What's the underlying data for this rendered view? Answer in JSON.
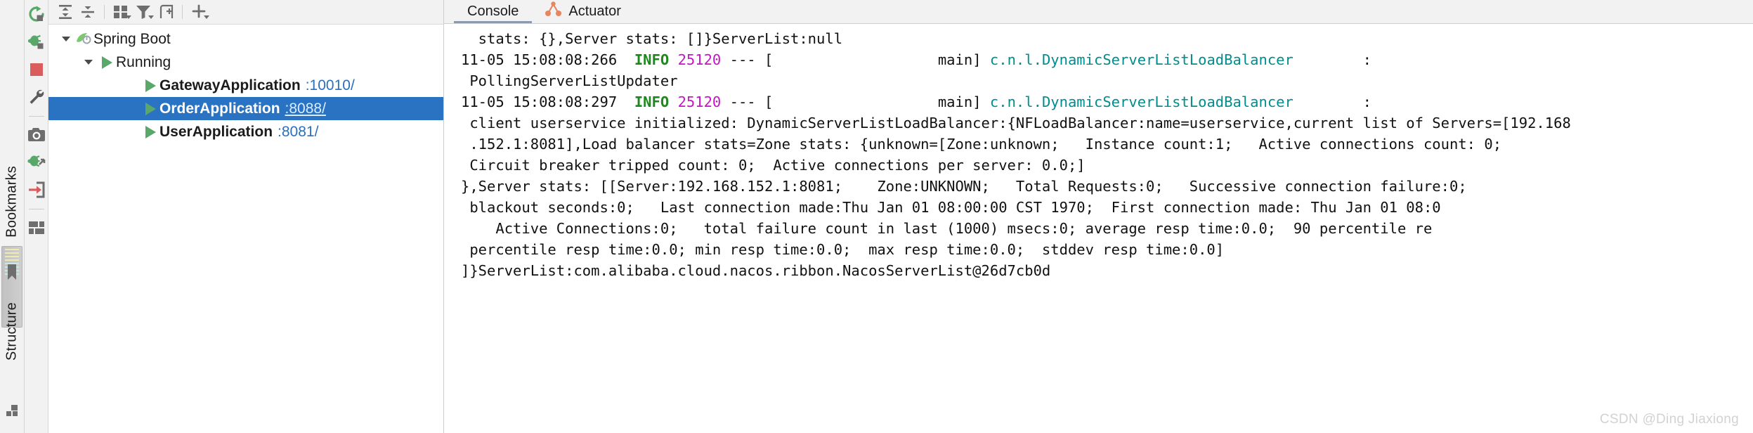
{
  "strip": {
    "bookmarks_label": "Bookmarks",
    "structure_label": "Structure",
    "bookmark_icon": "bookmark-icon",
    "bottom_icon": "layout-icon"
  },
  "run_toolbar": {
    "buttons": [
      {
        "name": "rerun-button",
        "icon": "rerun-icon",
        "color": "#59a869"
      },
      {
        "name": "rerun-debug-button",
        "icon": "debug-rerun-icon",
        "color": "#59a869"
      },
      {
        "name": "stop-button",
        "icon": "stop-square-icon",
        "color": "#db5c5c"
      },
      {
        "name": "settings-button",
        "icon": "wrench-icon",
        "color": "#5c5c5c"
      },
      {
        "name": "screenshot-button",
        "icon": "camera-icon",
        "color": "#6e6e6e"
      },
      {
        "name": "attach-debugger-button",
        "icon": "debug-attach-icon",
        "color": "#59a869"
      },
      {
        "name": "import-button",
        "icon": "arrow-into-box-icon",
        "color": "#db5c5c"
      },
      {
        "name": "layout-button",
        "icon": "layout-icon",
        "color": "#6e6e6e"
      }
    ]
  },
  "tree_toolbar": {
    "buttons": [
      {
        "name": "expand-all-button",
        "icon": "expand-all-icon",
        "caret": false
      },
      {
        "name": "collapse-all-button",
        "icon": "collapse-all-icon",
        "caret": false
      },
      {
        "name": "group-by-button",
        "icon": "group-by-icon",
        "caret": true
      },
      {
        "name": "filter-button",
        "icon": "filter-icon",
        "caret": true
      },
      {
        "name": "add-endpoint-button",
        "icon": "add-frame-icon",
        "caret": false
      },
      {
        "name": "add-button",
        "icon": "plus-icon",
        "caret": true
      }
    ]
  },
  "tabs": [
    {
      "label": "Console",
      "icon": "console-icon",
      "active": true
    },
    {
      "label": "Actuator",
      "icon": "actuator-icon",
      "active": false
    }
  ],
  "tree": {
    "nodes": [
      {
        "label": "Spring Boot",
        "port": "",
        "icon": "spring-boot-icon",
        "indent": 0,
        "expanded": true,
        "bold": false,
        "selected": false,
        "name": "tree-node-spring-boot"
      },
      {
        "label": "Running",
        "port": "",
        "icon": "play-icon",
        "indent": 1,
        "expanded": true,
        "bold": false,
        "selected": false,
        "name": "tree-node-running"
      },
      {
        "label": "GatewayApplication",
        "port": ":10010/",
        "icon": "play-icon",
        "indent": 2,
        "expanded": null,
        "bold": true,
        "selected": false,
        "name": "tree-node-gateway-application"
      },
      {
        "label": "OrderApplication",
        "port": ":8088/",
        "icon": "play-icon",
        "indent": 2,
        "expanded": null,
        "bold": true,
        "selected": true,
        "name": "tree-node-order-application"
      },
      {
        "label": "UserApplication",
        "port": ":8081/",
        "icon": "play-icon",
        "indent": 2,
        "expanded": null,
        "bold": true,
        "selected": false,
        "name": "tree-node-user-application"
      }
    ]
  },
  "console": {
    "lines": [
      {
        "segments": [
          {
            "t": "  stats: {},Server stats: []}ServerList:null",
            "c": "txt"
          }
        ]
      },
      {
        "segments": [
          {
            "t": "11-05 15:08:08:266 ",
            "c": "ts"
          },
          {
            "t": " INFO",
            "c": "info"
          },
          {
            "t": " ",
            "c": "txt"
          },
          {
            "t": "25120",
            "c": "pid"
          },
          {
            "t": " --- [                   main] ",
            "c": "txt"
          },
          {
            "t": "c.n.l.DynamicServerListLoadBalancer",
            "c": "cls"
          },
          {
            "t": "        :",
            "c": "txt"
          }
        ]
      },
      {
        "segments": [
          {
            "t": " PollingServerListUpdater",
            "c": "txt"
          }
        ]
      },
      {
        "segments": [
          {
            "t": "11-05 15:08:08:297 ",
            "c": "ts"
          },
          {
            "t": " INFO",
            "c": "info"
          },
          {
            "t": " ",
            "c": "txt"
          },
          {
            "t": "25120",
            "c": "pid"
          },
          {
            "t": " --- [                   main] ",
            "c": "txt"
          },
          {
            "t": "c.n.l.DynamicServerListLoadBalancer",
            "c": "cls"
          },
          {
            "t": "        :",
            "c": "txt"
          }
        ]
      },
      {
        "segments": [
          {
            "t": " client userservice initialized: DynamicServerListLoadBalancer:{NFLoadBalancer:name=userservice,current list of Servers=[192.168",
            "c": "txt"
          }
        ]
      },
      {
        "segments": [
          {
            "t": " .152.1:8081],Load balancer stats=Zone stats: {unknown=[Zone:unknown;   Instance count:1;   Active connections count: 0;",
            "c": "txt"
          }
        ]
      },
      {
        "segments": [
          {
            "t": " Circuit breaker tripped count: 0;  Active connections per server: 0.0;]",
            "c": "txt"
          }
        ]
      },
      {
        "segments": [
          {
            "t": "},Server stats: [[Server:192.168.152.1:8081;    Zone:UNKNOWN;   Total Requests:0;   Successive connection failure:0;",
            "c": "txt"
          }
        ]
      },
      {
        "segments": [
          {
            "t": " blackout seconds:0;   Last connection made:Thu Jan 01 08:00:00 CST 1970;  First connection made: Thu Jan 01 08:0",
            "c": "txt"
          }
        ]
      },
      {
        "segments": [
          {
            "t": "    Active Connections:0;   total failure count in last (1000) msecs:0; average resp time:0.0;  90 percentile re",
            "c": "txt"
          }
        ]
      },
      {
        "segments": [
          {
            "t": " percentile resp time:0.0; min resp time:0.0;  max resp time:0.0;  stddev resp time:0.0]",
            "c": "txt"
          }
        ]
      },
      {
        "segments": [
          {
            "t": "]}ServerList:com.alibaba.cloud.nacos.ribbon.NacosServerList@26d7cb0d",
            "c": "txt"
          }
        ]
      }
    ]
  },
  "watermark": "CSDN @Ding Jiaxiong",
  "colors": {
    "selection": "#2a73c2",
    "play_green": "#59a869",
    "stop_red": "#db5c5c",
    "link_blue": "#2b6fbd",
    "info_green": "#1b8a1b",
    "pid_magenta": "#c217c2",
    "class_teal": "#008d8d"
  }
}
